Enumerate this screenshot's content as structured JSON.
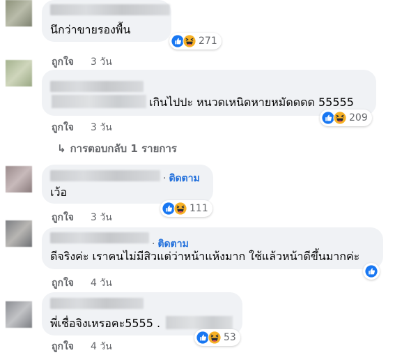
{
  "comments": [
    {
      "text": "นึกว่าขายรองพื้น",
      "reactions": {
        "icons": [
          "like-icon",
          "haha-icon"
        ],
        "count": "271"
      },
      "actions": {
        "like": "ถูกใจ",
        "time": "3 วัน"
      }
    },
    {
      "text": "เกินไปปะ หนวดเหนิดหายหมัดดดด 55555",
      "reactions": {
        "icons": [
          "like-icon",
          "haha-icon"
        ],
        "count": "209"
      },
      "actions": {
        "like": "ถูกใจ",
        "time": "3 วัน"
      },
      "replies": "การตอบกลับ 1 รายการ"
    },
    {
      "follow": "ติดตาม",
      "text": "เว้อ",
      "reactions": {
        "icons": [
          "like-icon",
          "haha-icon"
        ],
        "count": "111"
      },
      "actions": {
        "like": "ถูกใจ",
        "time": "3 วัน"
      }
    },
    {
      "follow": "ติดตาม",
      "text": "ดีจริงค่ะ เราคนไม่มีสิวแต่ว่าหน้าแห้งมาก ใช้แล้วหน้าดีขึ้นมากค่ะ",
      "reactions": {
        "icons": [
          "like-icon"
        ],
        "count": ""
      },
      "actions": {
        "like": "ถูกใจ",
        "time": "4 วัน"
      }
    },
    {
      "text": "พี่เชื่อจิงเหรอคะ5555 .",
      "reactions": {
        "icons": [
          "like-icon",
          "haha-icon"
        ],
        "count": "53"
      },
      "actions": {
        "like": "ถูกใจ",
        "time": "4 วัน"
      }
    }
  ],
  "colors": {
    "bubble": "#f0f2f5",
    "link": "#216fdb",
    "secondary_text": "#65676b",
    "like_blue": "#1877f2",
    "haha_yellow": "#f7b125"
  }
}
